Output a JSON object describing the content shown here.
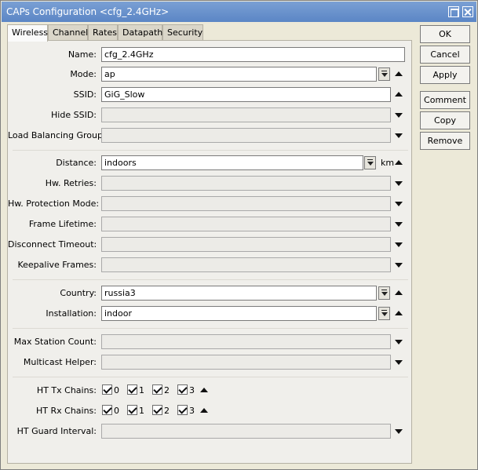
{
  "window": {
    "title": "CAPs Configuration <cfg_2.4GHz>"
  },
  "tabs": [
    {
      "label": "Wireless",
      "active": true
    },
    {
      "label": "Channel"
    },
    {
      "label": "Rates"
    },
    {
      "label": "Datapath"
    },
    {
      "label": "Security"
    }
  ],
  "form": {
    "name": {
      "label": "Name:",
      "value": "cfg_2.4GHz"
    },
    "mode": {
      "label": "Mode:",
      "value": "ap"
    },
    "ssid": {
      "label": "SSID:",
      "value": "GiG_Slow"
    },
    "hide_ssid": {
      "label": "Hide SSID:",
      "value": ""
    },
    "load_balancing_group": {
      "label": "Load Balancing Group:",
      "value": ""
    },
    "distance": {
      "label": "Distance:",
      "value": "indoors",
      "unit": "km"
    },
    "hw_retries": {
      "label": "Hw. Retries:",
      "value": ""
    },
    "hw_protection_mode": {
      "label": "Hw. Protection Mode:",
      "value": ""
    },
    "frame_lifetime": {
      "label": "Frame Lifetime:",
      "value": ""
    },
    "disconnect_timeout": {
      "label": "Disconnect Timeout:",
      "value": ""
    },
    "keepalive_frames": {
      "label": "Keepalive Frames:",
      "value": ""
    },
    "country": {
      "label": "Country:",
      "value": "russia3"
    },
    "installation": {
      "label": "Installation:",
      "value": "indoor"
    },
    "max_station_count": {
      "label": "Max Station Count:",
      "value": ""
    },
    "multicast_helper": {
      "label": "Multicast Helper:",
      "value": ""
    },
    "ht_tx_chains": {
      "label": "HT Tx Chains:",
      "chains": [
        "0",
        "1",
        "2",
        "3"
      ]
    },
    "ht_rx_chains": {
      "label": "HT Rx Chains:",
      "chains": [
        "0",
        "1",
        "2",
        "3"
      ]
    },
    "ht_guard_interval": {
      "label": "HT Guard Interval:",
      "value": ""
    }
  },
  "buttons": {
    "ok": "OK",
    "cancel": "Cancel",
    "apply": "Apply",
    "comment": "Comment",
    "copy": "Copy",
    "remove": "Remove"
  }
}
